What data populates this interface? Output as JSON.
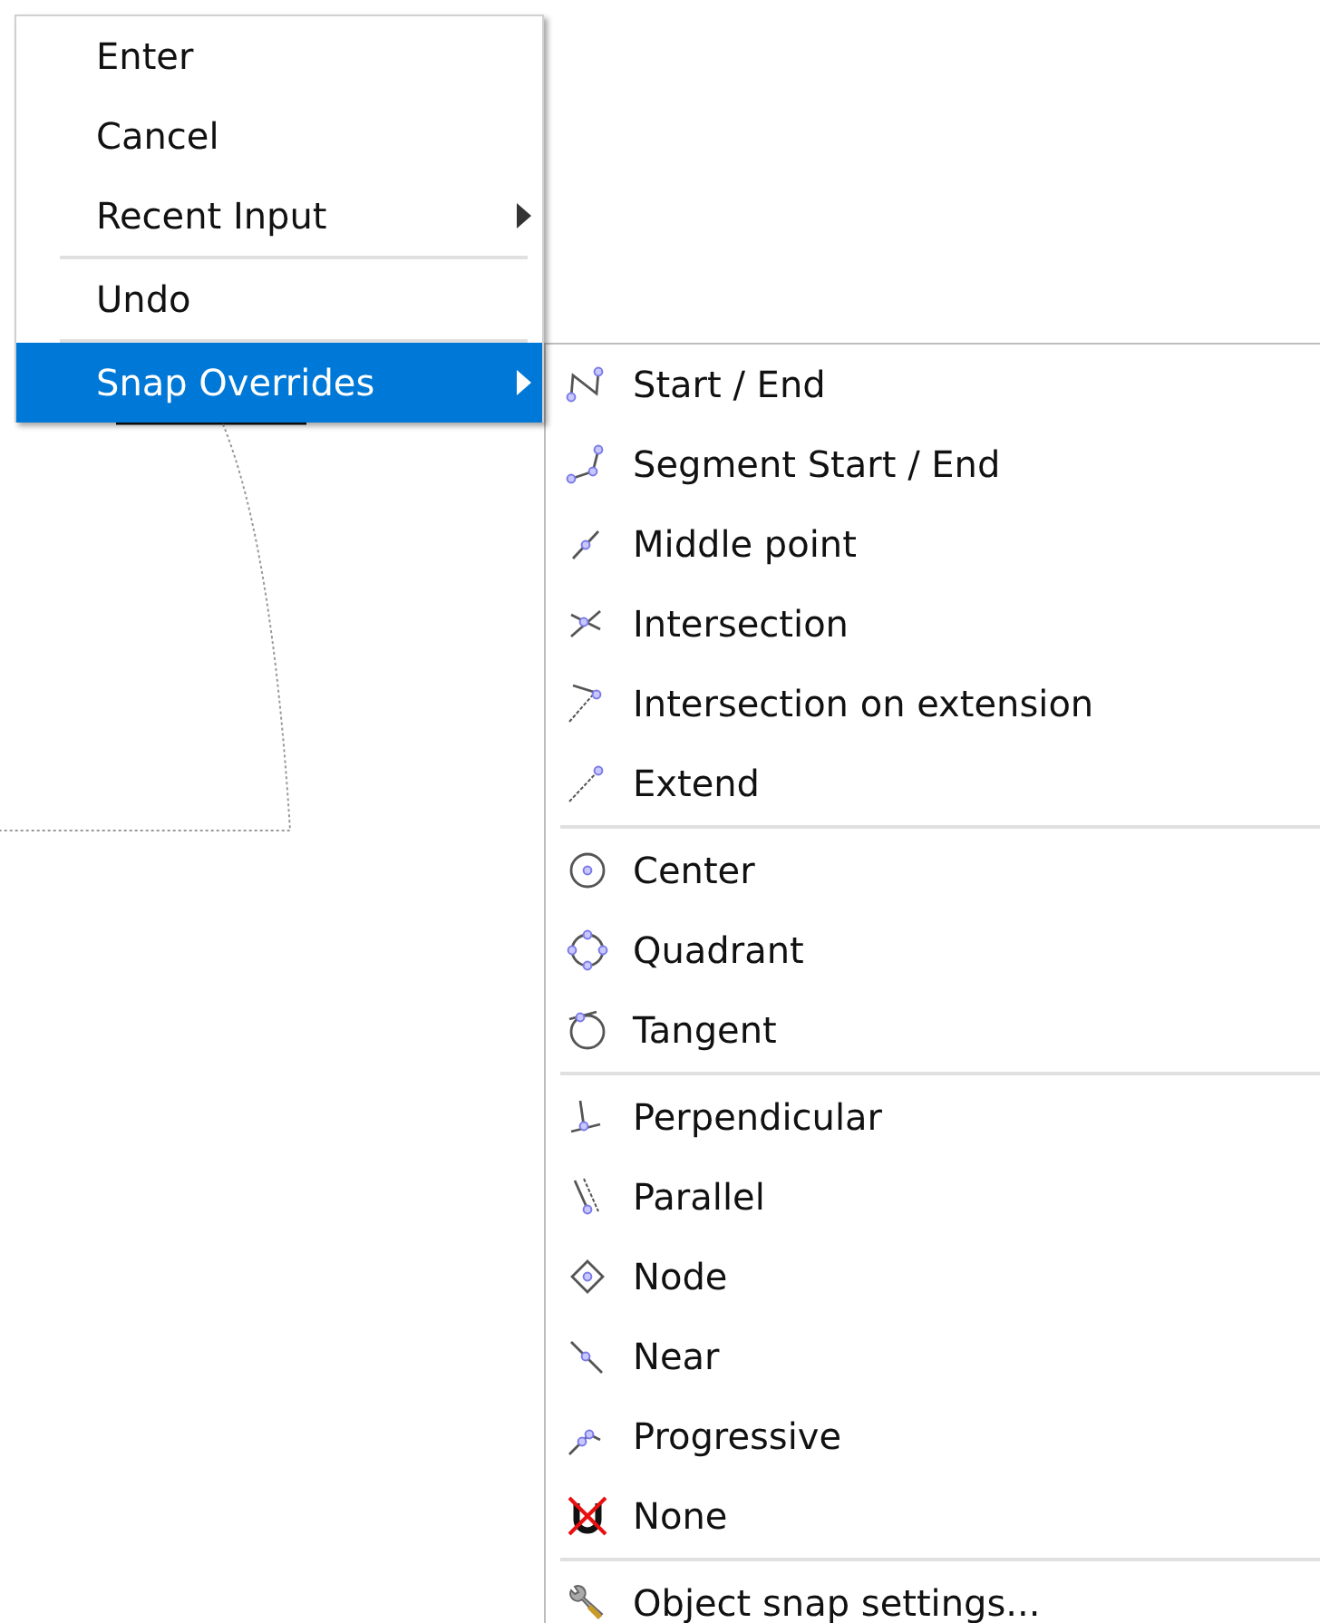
{
  "context_menu": {
    "groups": [
      [
        {
          "label": "Enter",
          "has_submenu": false,
          "selected": false
        },
        {
          "label": "Cancel",
          "has_submenu": false,
          "selected": false
        },
        {
          "label": "Recent Input",
          "has_submenu": true,
          "selected": false
        }
      ],
      [
        {
          "label": "Undo",
          "has_submenu": false,
          "selected": false
        }
      ],
      [
        {
          "label": "Snap Overrides",
          "has_submenu": true,
          "selected": true
        }
      ]
    ]
  },
  "snap_submenu": {
    "groups": [
      [
        {
          "label": "Start / End",
          "kind": "endpoint"
        },
        {
          "label": "Segment Start / End",
          "kind": "segment"
        },
        {
          "label": "Middle point",
          "kind": "midpoint"
        },
        {
          "label": "Intersection",
          "kind": "intersection"
        },
        {
          "label": "Intersection on extension",
          "kind": "extintersection"
        },
        {
          "label": "Extend",
          "kind": "extend"
        }
      ],
      [
        {
          "label": "Center",
          "kind": "center"
        },
        {
          "label": "Quadrant",
          "kind": "quadrant"
        },
        {
          "label": "Tangent",
          "kind": "tangent"
        }
      ],
      [
        {
          "label": "Perpendicular",
          "kind": "perpendicular"
        },
        {
          "label": "Parallel",
          "kind": "parallel"
        },
        {
          "label": "Node",
          "kind": "node"
        },
        {
          "label": "Near",
          "kind": "near"
        },
        {
          "label": "Progressive",
          "kind": "progressive"
        },
        {
          "label": "None",
          "kind": "none"
        }
      ],
      [
        {
          "label": "Object snap settings...",
          "kind": "settings"
        }
      ]
    ]
  }
}
